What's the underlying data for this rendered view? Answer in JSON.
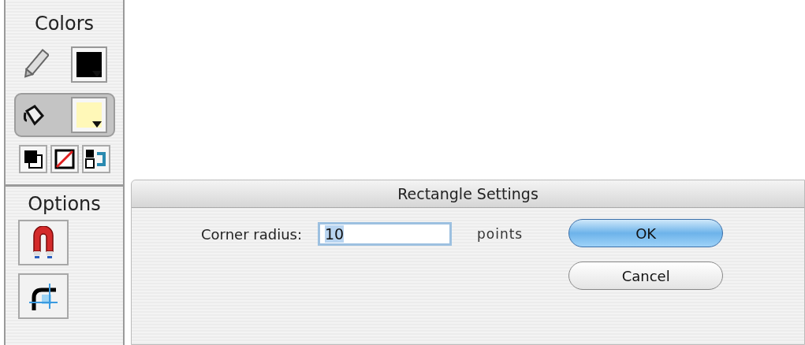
{
  "toolbar": {
    "colors_title": "Colors",
    "color_rows": [
      {
        "kind": "stroke",
        "color": "#000000",
        "selected": false
      },
      {
        "kind": "fill",
        "color": "#fff8b8",
        "selected": true
      }
    ],
    "color_buttons": [
      {
        "kind": "black-white"
      },
      {
        "kind": "no-color"
      },
      {
        "kind": "swap"
      }
    ],
    "options_title": "Options",
    "options": [
      {
        "kind": "snap",
        "selected": false
      },
      {
        "kind": "smooth",
        "selected": false
      }
    ]
  },
  "dialog": {
    "title": "Rectangle Settings",
    "field_label": "Corner radius:",
    "field_value": "10",
    "unit": "points",
    "buttons": [
      {
        "label": "OK",
        "default": true
      },
      {
        "label": "Cancel",
        "default": false
      }
    ]
  }
}
